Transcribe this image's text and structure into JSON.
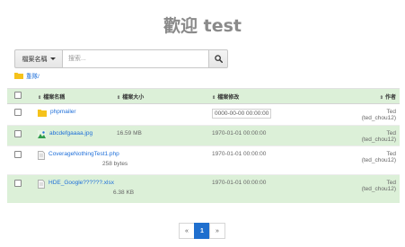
{
  "page": {
    "title": "歡迎 test"
  },
  "search": {
    "field_label": "檔案名稱",
    "placeholder": "搜索...",
    "value": ""
  },
  "breadcrumb": {
    "label": "重隊/"
  },
  "table": {
    "headers": {
      "name": "檔案名稱",
      "size": "檔案大小",
      "modified": "檔案修改",
      "owner": "作者"
    },
    "rows": [
      {
        "name": "phpmailer",
        "icon": "folder-icon",
        "size": "",
        "modified": "0000-00-00 00:00:00",
        "owner": "Ted (ted_chou12)"
      },
      {
        "name": "abcdefgaaaa.jpg",
        "icon": "image-file-icon",
        "size": "16.59 MB",
        "modified": "1970-01-01 00:00:00",
        "owner": "Ted (ted_chou12)"
      },
      {
        "name": "CoverageNothingTest1.php",
        "icon": "text-file-icon",
        "size": "258 bytes",
        "modified": "1970-01-01 00:00:00",
        "owner": "Ted (ted_chou12)"
      },
      {
        "name": "HDE_Google??????.xlsx",
        "icon": "text-file-icon",
        "size": "6.38 KB",
        "modified": "1970-01-01 00:00:00",
        "owner": "Ted (ted_chou12)"
      }
    ]
  },
  "pagination": {
    "prev": "«",
    "current": "1",
    "next": "»"
  },
  "colors": {
    "accent": "#1f6fce",
    "row_highlight": "#dcf0d8",
    "folder": "#f5c21b"
  }
}
